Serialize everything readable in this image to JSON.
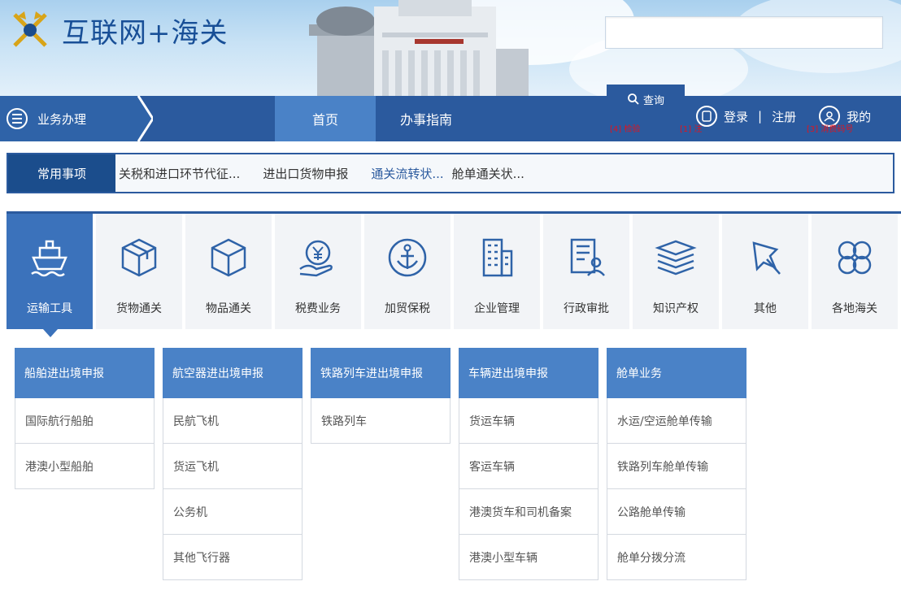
{
  "site": {
    "title": "互联网+海关",
    "search_placeholder": "",
    "query_label": "查询"
  },
  "nav": {
    "business_label": "业务办理",
    "home_label": "首页",
    "guide_label": "办事指南",
    "login_label": "登录",
    "separator": "|",
    "register_label": "注册",
    "mine_label": "我的",
    "notes": [
      "[4] 检验",
      "[1] 注",
      "[3] 消费码号"
    ]
  },
  "common": {
    "title": "常用事项",
    "links": [
      "关税和进口环节代征...",
      "进出口货物申报",
      "通关流转状...",
      "舱单通关状..."
    ]
  },
  "categories": [
    {
      "label": "运输工具",
      "icon": "ship-icon"
    },
    {
      "label": "货物通关",
      "icon": "package-icon"
    },
    {
      "label": "物品通关",
      "icon": "box-icon"
    },
    {
      "label": "税费业务",
      "icon": "yuan-hand-icon"
    },
    {
      "label": "加贸保税",
      "icon": "anchor-icon"
    },
    {
      "label": "企业管理",
      "icon": "building-icon"
    },
    {
      "label": "行政审批",
      "icon": "document-person-icon"
    },
    {
      "label": "知识产权",
      "icon": "books-icon"
    },
    {
      "label": "其他",
      "icon": "pin-icon"
    },
    {
      "label": "各地海关",
      "icon": "clover-icon"
    }
  ],
  "panels": [
    {
      "title": "船舶进出境申报",
      "items": [
        "国际航行船舶",
        "港澳小型船舶"
      ]
    },
    {
      "title": "航空器进出境申报",
      "items": [
        "民航飞机",
        "货运飞机",
        "公务机",
        "其他飞行器"
      ]
    },
    {
      "title": "铁路列车进出境申报",
      "items": [
        "铁路列车"
      ]
    },
    {
      "title": "车辆进出境申报",
      "items": [
        "货运车辆",
        "客运车辆",
        "港澳货车和司机备案",
        "港澳小型车辆"
      ]
    },
    {
      "title": "舱单业务",
      "items": [
        "水运/空运舱单传输",
        "铁路列车舱单传输",
        "公路舱单传输",
        "舱单分拨分流"
      ]
    }
  ],
  "colors": {
    "nav_blue": "#2b5a9e",
    "active_blue": "#3b72bb",
    "panel_head": "#4a82c7",
    "note_red": "#e0141e"
  }
}
